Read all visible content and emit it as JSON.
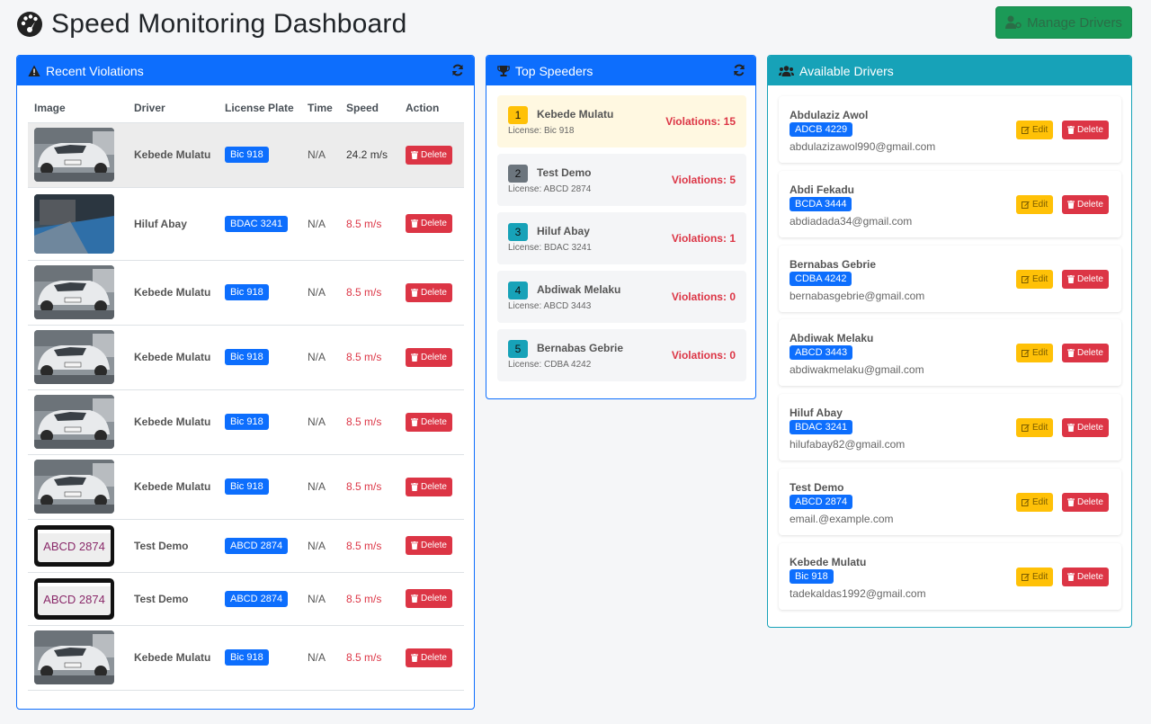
{
  "header": {
    "title": "Speed Monitoring Dashboard",
    "manage_label": "Manage Drivers"
  },
  "violations": {
    "title": "Recent Violations",
    "columns": [
      "Image",
      "Driver",
      "License Plate",
      "Time",
      "Speed",
      "Action"
    ],
    "delete_label": "Delete",
    "rows": [
      {
        "image": "car",
        "driver": "Kebede Mulatu",
        "plate": "Bic 918",
        "time": "N/A",
        "speed": "24.2 m/s"
      },
      {
        "image": "street",
        "driver": "Hiluf Abay",
        "plate": "BDAC 3241",
        "time": "N/A",
        "speed": "8.5 m/s"
      },
      {
        "image": "car",
        "driver": "Kebede Mulatu",
        "plate": "Bic 918",
        "time": "N/A",
        "speed": "8.5 m/s"
      },
      {
        "image": "car",
        "driver": "Kebede Mulatu",
        "plate": "Bic 918",
        "time": "N/A",
        "speed": "8.5 m/s"
      },
      {
        "image": "car",
        "driver": "Kebede Mulatu",
        "plate": "Bic 918",
        "time": "N/A",
        "speed": "8.5 m/s"
      },
      {
        "image": "car",
        "driver": "Kebede Mulatu",
        "plate": "Bic 918",
        "time": "N/A",
        "speed": "8.5 m/s"
      },
      {
        "image": "plate",
        "plate_text": "ABCD 2874",
        "driver": "Test Demo",
        "plate": "ABCD 2874",
        "time": "N/A",
        "speed": "8.5 m/s"
      },
      {
        "image": "plate",
        "plate_text": "ABCD 2874",
        "driver": "Test Demo",
        "plate": "ABCD 2874",
        "time": "N/A",
        "speed": "8.5 m/s"
      },
      {
        "image": "car",
        "driver": "Kebede Mulatu",
        "plate": "Bic 918",
        "time": "N/A",
        "speed": "8.5 m/s"
      }
    ]
  },
  "speeders": {
    "title": "Top Speeders",
    "items": [
      {
        "rank": "1",
        "name": "Kebede Mulatu",
        "license": "License: Bic 918",
        "violations": "Violations: 15",
        "color": "#ffc107"
      },
      {
        "rank": "2",
        "name": "Test Demo",
        "license": "License: ABCD 2874",
        "violations": "Violations: 5",
        "color": "#6c757d"
      },
      {
        "rank": "3",
        "name": "Hiluf Abay",
        "license": "License: BDAC 3241",
        "violations": "Violations: 1",
        "color": "#17a2b8"
      },
      {
        "rank": "4",
        "name": "Abdiwak Melaku",
        "license": "License: ABCD 3443",
        "violations": "Violations: 0",
        "color": "#17a2b8"
      },
      {
        "rank": "5",
        "name": "Bernabas Gebrie",
        "license": "License: CDBA 4242",
        "violations": "Violations: 0",
        "color": "#17a2b8"
      }
    ]
  },
  "drivers": {
    "title": "Available Drivers",
    "edit_label": "Edit",
    "delete_label": "Delete",
    "items": [
      {
        "name": "Abdulaziz Awol",
        "plate": "ADCB 4229",
        "email": "abdulazizawol990@gmail.com"
      },
      {
        "name": "Abdi Fekadu",
        "plate": "BCDA 3444",
        "email": "abdiadada34@gmail.com"
      },
      {
        "name": "Bernabas Gebrie",
        "plate": "CDBA 4242",
        "email": "bernabasgebrie@gmail.com"
      },
      {
        "name": "Abdiwak Melaku",
        "plate": "ABCD 3443",
        "email": "abdiwakmelaku@gmail.com"
      },
      {
        "name": "Hiluf Abay",
        "plate": "BDAC 3241",
        "email": "hilufabay82@gmail.com"
      },
      {
        "name": "Test Demo",
        "plate": "ABCD 2874",
        "email": "email.@example.com"
      },
      {
        "name": "Kebede Mulatu",
        "plate": "Bic 918",
        "email": "tadekaldas1992@gmail.com"
      }
    ]
  },
  "colors": {
    "primary": "#0d6efd",
    "info": "#17a2b8",
    "danger": "#dc3545",
    "success": "#1b9a57",
    "warning": "#ffc107"
  }
}
